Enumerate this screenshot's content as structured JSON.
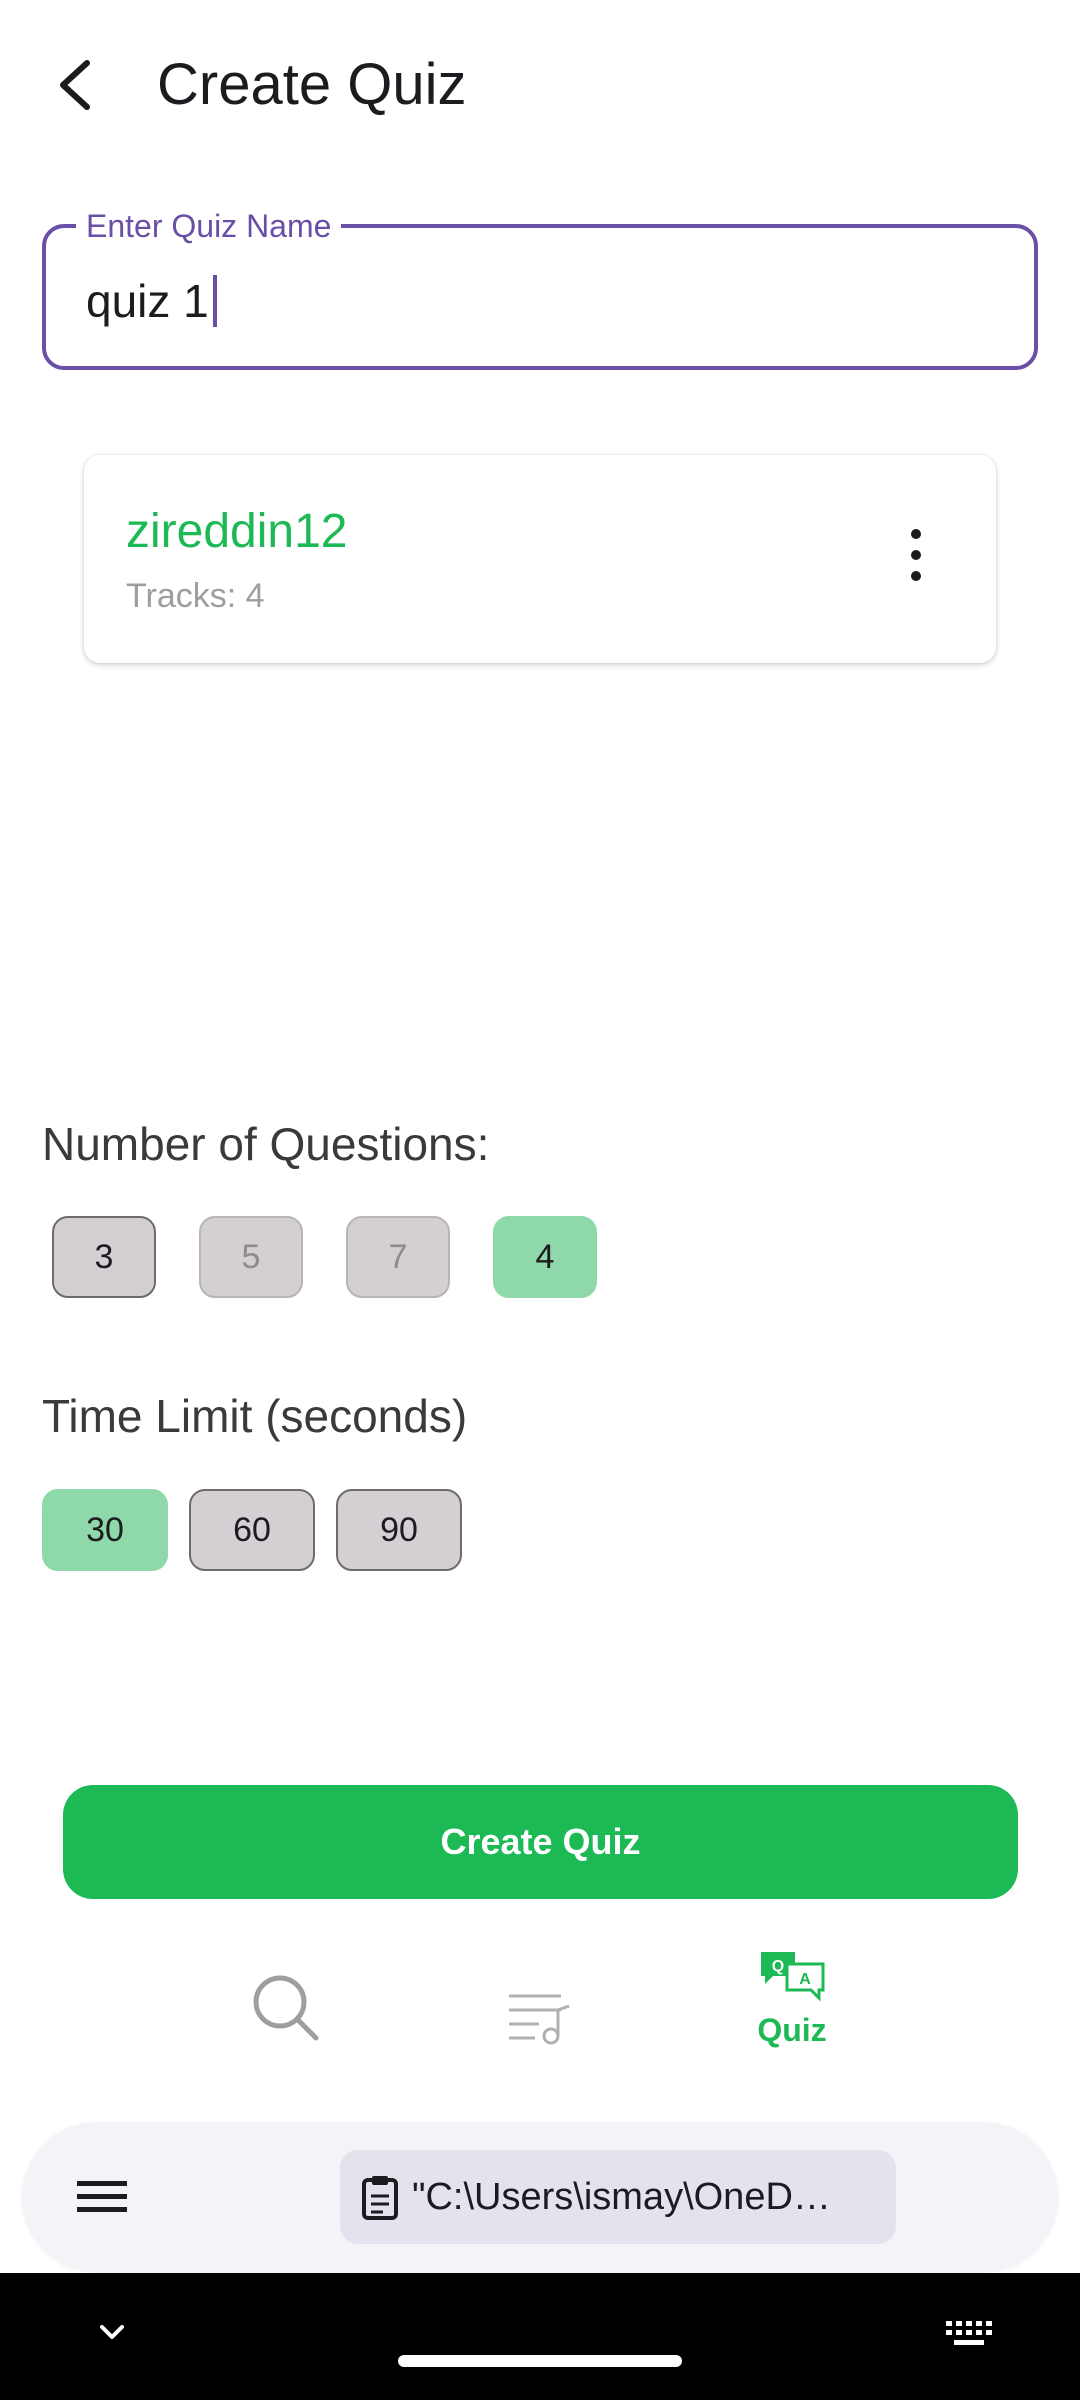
{
  "app_bar": {
    "title": "Create Quiz",
    "back_icon": "arrow-back-icon"
  },
  "quiz_name_field": {
    "label": "Enter Quiz Name",
    "value": "quiz 1",
    "accent_color": "#6a4fa6"
  },
  "playlist_card": {
    "name": "zireddin12",
    "tracks_text": "Tracks: 4",
    "menu_icon": "more-vert-icon",
    "name_color": "#1db954"
  },
  "questions": {
    "label": "Number of Questions:",
    "options": [
      {
        "label": "3",
        "state": "normal"
      },
      {
        "label": "5",
        "state": "disabled"
      },
      {
        "label": "7",
        "state": "disabled"
      },
      {
        "label": "4",
        "state": "selected"
      }
    ]
  },
  "time_limit": {
    "label": "Time Limit (seconds)",
    "options": [
      {
        "label": "30",
        "state": "selected"
      },
      {
        "label": "60",
        "state": "normal"
      },
      {
        "label": "90",
        "state": "normal"
      }
    ]
  },
  "create_button": {
    "label": "Create Quiz",
    "color": "#1db954"
  },
  "bottom_nav": {
    "items": [
      {
        "icon": "search-icon",
        "label": "",
        "active": false
      },
      {
        "icon": "playlist-music-icon",
        "label": "",
        "active": false
      },
      {
        "icon": "quiz-qa-icon",
        "label": "Quiz",
        "active": true
      }
    ],
    "active_color": "#1db954"
  },
  "keyboard_toolbar": {
    "menu_icon": "hamburger-menu-icon",
    "clipboard_icon": "clipboard-icon",
    "clipboard_text": "\"C:\\Users\\ismay\\OneD…"
  },
  "system_nav": {
    "collapse_icon": "chevron-down-icon",
    "keyboard_icon": "keyboard-icon"
  }
}
